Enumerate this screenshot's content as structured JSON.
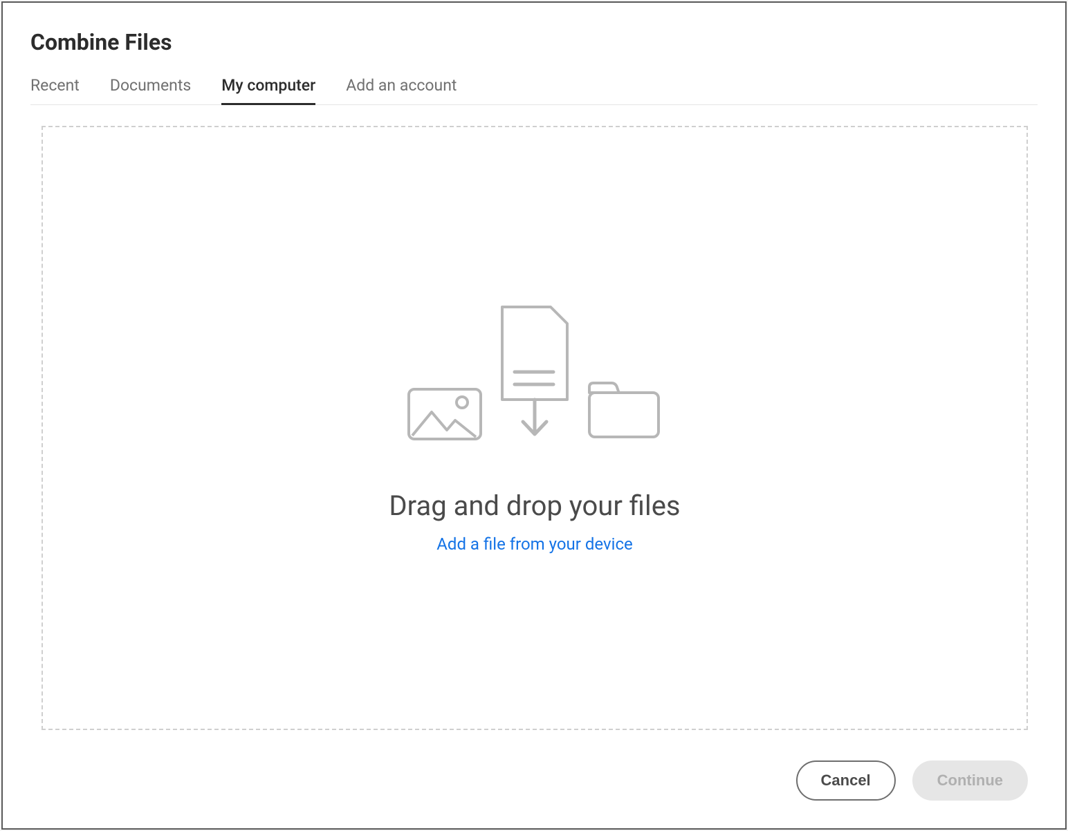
{
  "header": {
    "title": "Combine Files"
  },
  "tabs": [
    {
      "label": "Recent",
      "active": false
    },
    {
      "label": "Documents",
      "active": false
    },
    {
      "label": "My computer",
      "active": true
    },
    {
      "label": "Add an account",
      "active": false
    }
  ],
  "dropzone": {
    "title": "Drag and drop your files",
    "link_text": "Add a file from your device"
  },
  "footer": {
    "cancel_label": "Cancel",
    "continue_label": "Continue"
  }
}
